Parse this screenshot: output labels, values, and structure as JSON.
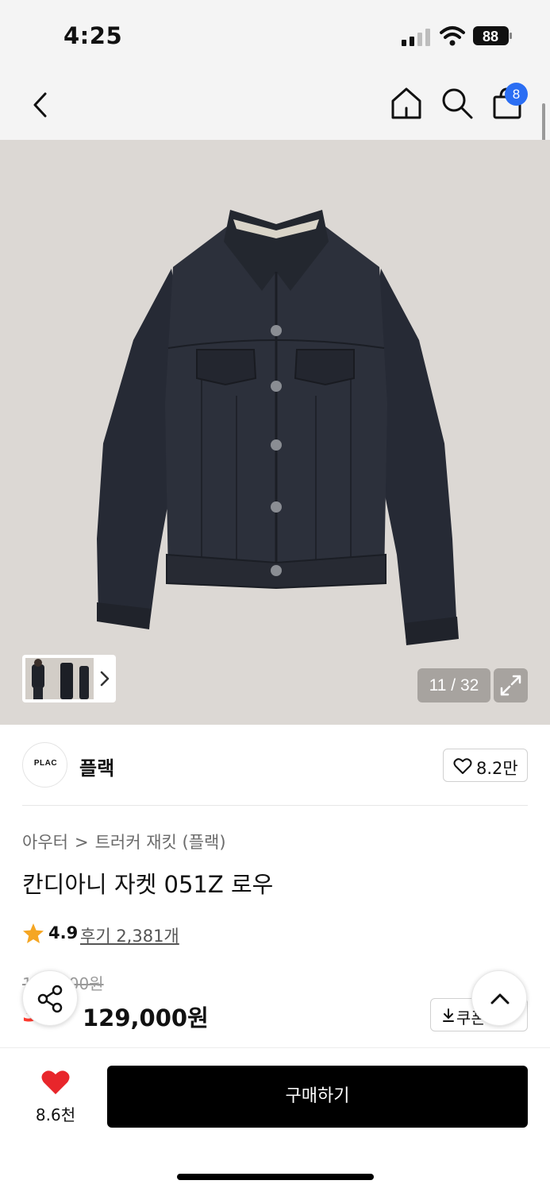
{
  "status_bar": {
    "time": "4:25",
    "battery": "88",
    "icons": [
      "signal-icon",
      "wifi-icon",
      "battery-icon"
    ]
  },
  "nav": {
    "icons": [
      "back-icon",
      "home-icon",
      "search-icon",
      "shopping-bag-icon"
    ],
    "cart_count": "8"
  },
  "gallery": {
    "counter": "11 / 32",
    "icons": [
      "expand-icon",
      "chevron-right-icon"
    ]
  },
  "brand": {
    "logo_text": "PLAC",
    "name": "플랙",
    "like_count": "8.2만"
  },
  "product": {
    "breadcrumb": [
      "아우터",
      "트러커 재킷 (플랙)"
    ],
    "breadcrumb_separator": ">",
    "title": "칸디아니 자켓 051Z 로우",
    "rating": "4.9",
    "review_link": "후기 2,381개",
    "original_price": "1",
    "original_price_tail": "00원",
    "discount_rate": "3",
    "sale_price": "129,000원",
    "coupon_label": "쿠폰"
  },
  "bottom_bar": {
    "wish_count": "8.6천",
    "buy_label": "구매하기"
  },
  "colors": {
    "accent_blue": "#2b6ef3",
    "discount_red": "#ff3b2f",
    "heart_red": "#e8262b",
    "star_orange": "#f5a623",
    "hero_bg": "#dcd8d4",
    "buy_button": "#000000"
  }
}
